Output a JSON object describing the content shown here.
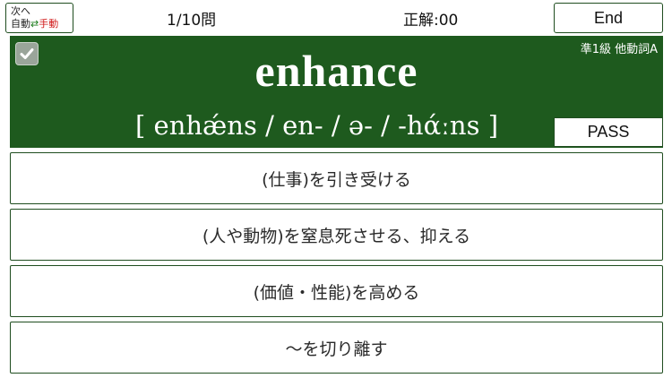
{
  "mode_toggle": {
    "line1": "次へ",
    "auto": "自動",
    "swap_symbol": "⇄",
    "manual": "手動"
  },
  "header": {
    "counter": "1/10問",
    "score": "正解:00",
    "end_label": "End"
  },
  "card": {
    "checked": true,
    "level": "準1級  他動詞A",
    "headword": "enhance",
    "pronunciation": "[ enhǽns / en- / ə- / -hάːns ]",
    "pass_label": "PASS",
    "background_color": "#1e5a1e"
  },
  "choices": [
    {
      "label": "(仕事)を引き受ける"
    },
    {
      "label": "(人や動物)を窒息死させる、抑える"
    },
    {
      "label": "(価値・性能)を高める"
    },
    {
      "label": "～を切り離す"
    }
  ],
  "colors": {
    "accent_green": "#1e5a1e",
    "manual_red": "#d01818"
  }
}
